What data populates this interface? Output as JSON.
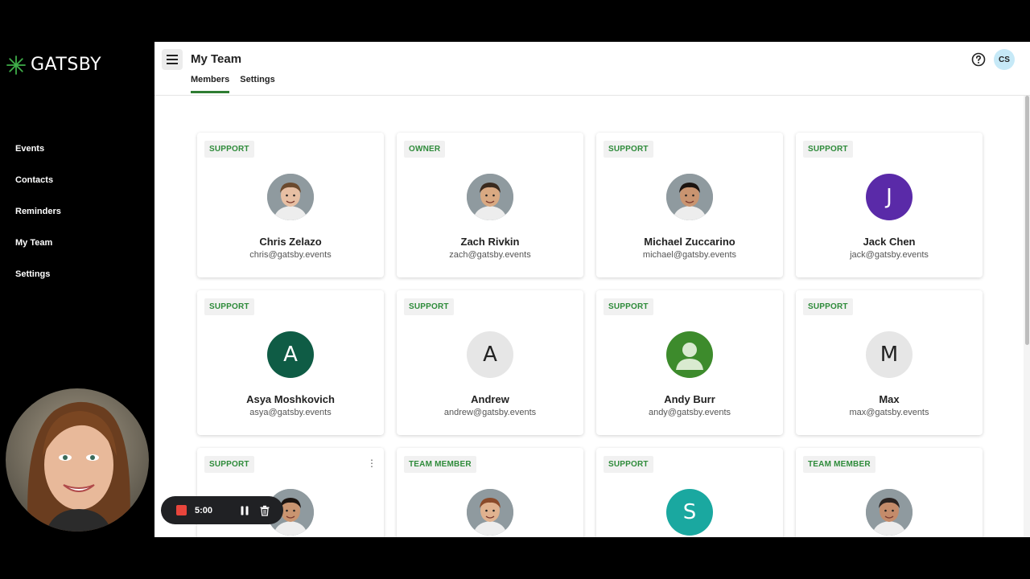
{
  "brand": {
    "logo_text": "GATSBY",
    "accent": "#2e7d32"
  },
  "sidebar": {
    "items": [
      {
        "label": "Events"
      },
      {
        "label": "Contacts"
      },
      {
        "label": "Reminders"
      },
      {
        "label": "My Team"
      },
      {
        "label": "Settings"
      }
    ]
  },
  "header": {
    "title": "My Team",
    "tabs": [
      {
        "label": "Members",
        "active": true
      },
      {
        "label": "Settings",
        "active": false
      }
    ],
    "user_initials": "CS",
    "help_icon": "help-circle-icon",
    "menu_icon": "hamburger-menu-icon"
  },
  "members": [
    {
      "role": "SUPPORT",
      "name": "Chris Zelazo",
      "email": "chris@gatsby.events",
      "avatar": "photo"
    },
    {
      "role": "OWNER",
      "name": "Zach Rivkin",
      "email": "zach@gatsby.events",
      "avatar": "photo"
    },
    {
      "role": "SUPPORT",
      "name": "Michael Zuccarino",
      "email": "michael@gatsby.events",
      "avatar": "photo"
    },
    {
      "role": "SUPPORT",
      "name": "Jack Chen",
      "email": "jack@gatsby.events",
      "avatar_letter": "J",
      "avatar_color": "#5a2aa8"
    },
    {
      "role": "SUPPORT",
      "name": "Asya Moshkovich",
      "email": "asya@gatsby.events",
      "avatar_letter": "A",
      "avatar_color": "#0f5c45"
    },
    {
      "role": "SUPPORT",
      "name": "Andrew",
      "email": "andrew@gatsby.events",
      "avatar_letter": "A",
      "avatar_color": "#e6e6e6"
    },
    {
      "role": "SUPPORT",
      "name": "Andy Burr",
      "email": "andy@gatsby.events",
      "avatar": "person-icon",
      "avatar_color": "#3d8b2c"
    },
    {
      "role": "SUPPORT",
      "name": "Max",
      "email": "max@gatsby.events",
      "avatar_letter": "M",
      "avatar_color": "#e6e6e6"
    },
    {
      "role": "SUPPORT",
      "name": "",
      "email": "",
      "avatar": "photo"
    },
    {
      "role": "TEAM MEMBER",
      "name": "",
      "email": "",
      "avatar": "photo"
    },
    {
      "role": "SUPPORT",
      "name": "",
      "email": "",
      "avatar_letter": "S",
      "avatar_color": "#1aa8a0"
    },
    {
      "role": "TEAM MEMBER",
      "name": "",
      "email": "",
      "avatar": "photo"
    }
  ],
  "recorder": {
    "time": "5:00",
    "stop_icon": "stop-icon",
    "pause_icon": "pause-icon",
    "delete_icon": "trash-icon"
  }
}
